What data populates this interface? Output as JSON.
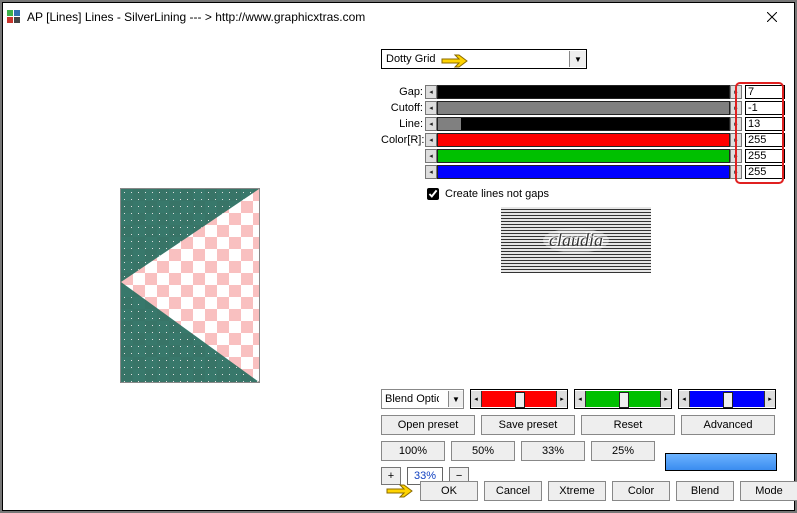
{
  "title": "AP [Lines]  Lines - SilverLining    --- >  http://www.graphicxtras.com",
  "preset_dropdown": {
    "selected": "Dotty Grid"
  },
  "sliders": {
    "gap": {
      "label": "Gap:",
      "value": "7",
      "fill_color": "#000000",
      "fill_pct": 5
    },
    "cutoff": {
      "label": "Cutoff:",
      "value": "-1",
      "fill_color": "#808080",
      "fill_pct": 100
    },
    "line": {
      "label": "Line:",
      "value": "13",
      "fill_color": "#808080",
      "fill_pct": 8
    },
    "r": {
      "label": "Color[R]:",
      "value": "255",
      "fill_color": "#ff0000",
      "fill_pct": 100
    },
    "g": {
      "label": "",
      "value": "255",
      "fill_color": "#00c000",
      "fill_pct": 100
    },
    "b": {
      "label": "",
      "value": "255",
      "fill_color": "#0000ff",
      "fill_pct": 100
    }
  },
  "checkbox": {
    "label": "Create lines not gaps",
    "checked": true
  },
  "logo_text": "claudia",
  "blend_dropdown": {
    "label": "Blend Options"
  },
  "color_sliders": [
    {
      "color": "#ff0000"
    },
    {
      "color": "#00c000"
    },
    {
      "color": "#0000ff"
    }
  ],
  "preset_buttons": {
    "open": "Open preset",
    "save": "Save preset",
    "reset": "Reset",
    "adv": "Advanced"
  },
  "zoom_buttons": {
    "z100": "100%",
    "z50": "50%",
    "z33": "33%",
    "z25": "25%"
  },
  "zoom_value": "33%",
  "actions": {
    "ok": "OK",
    "cancel": "Cancel",
    "xtreme": "Xtreme",
    "color": "Color",
    "blend": "Blend",
    "mode": "Mode"
  },
  "swatch_color": "#5aa2f2"
}
